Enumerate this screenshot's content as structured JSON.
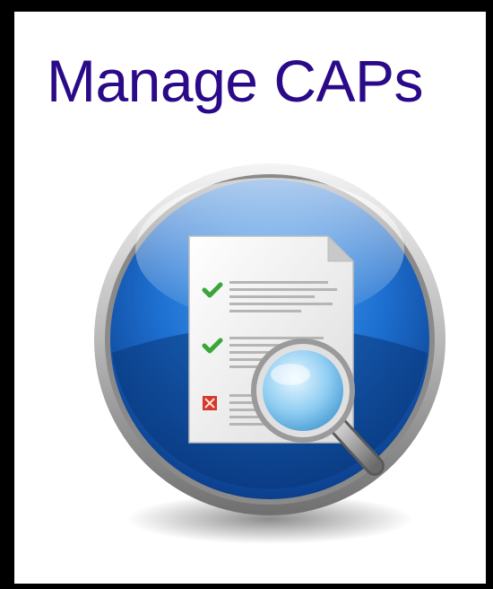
{
  "tile": {
    "title": "Manage CAPs",
    "icon": "document-search-icon"
  },
  "colors": {
    "title_text": "#2a0a88",
    "border": "#000000",
    "circle_blue": "#1d6fd0",
    "check_green": "#3aa63a",
    "cross_red": "#d33a2c"
  }
}
